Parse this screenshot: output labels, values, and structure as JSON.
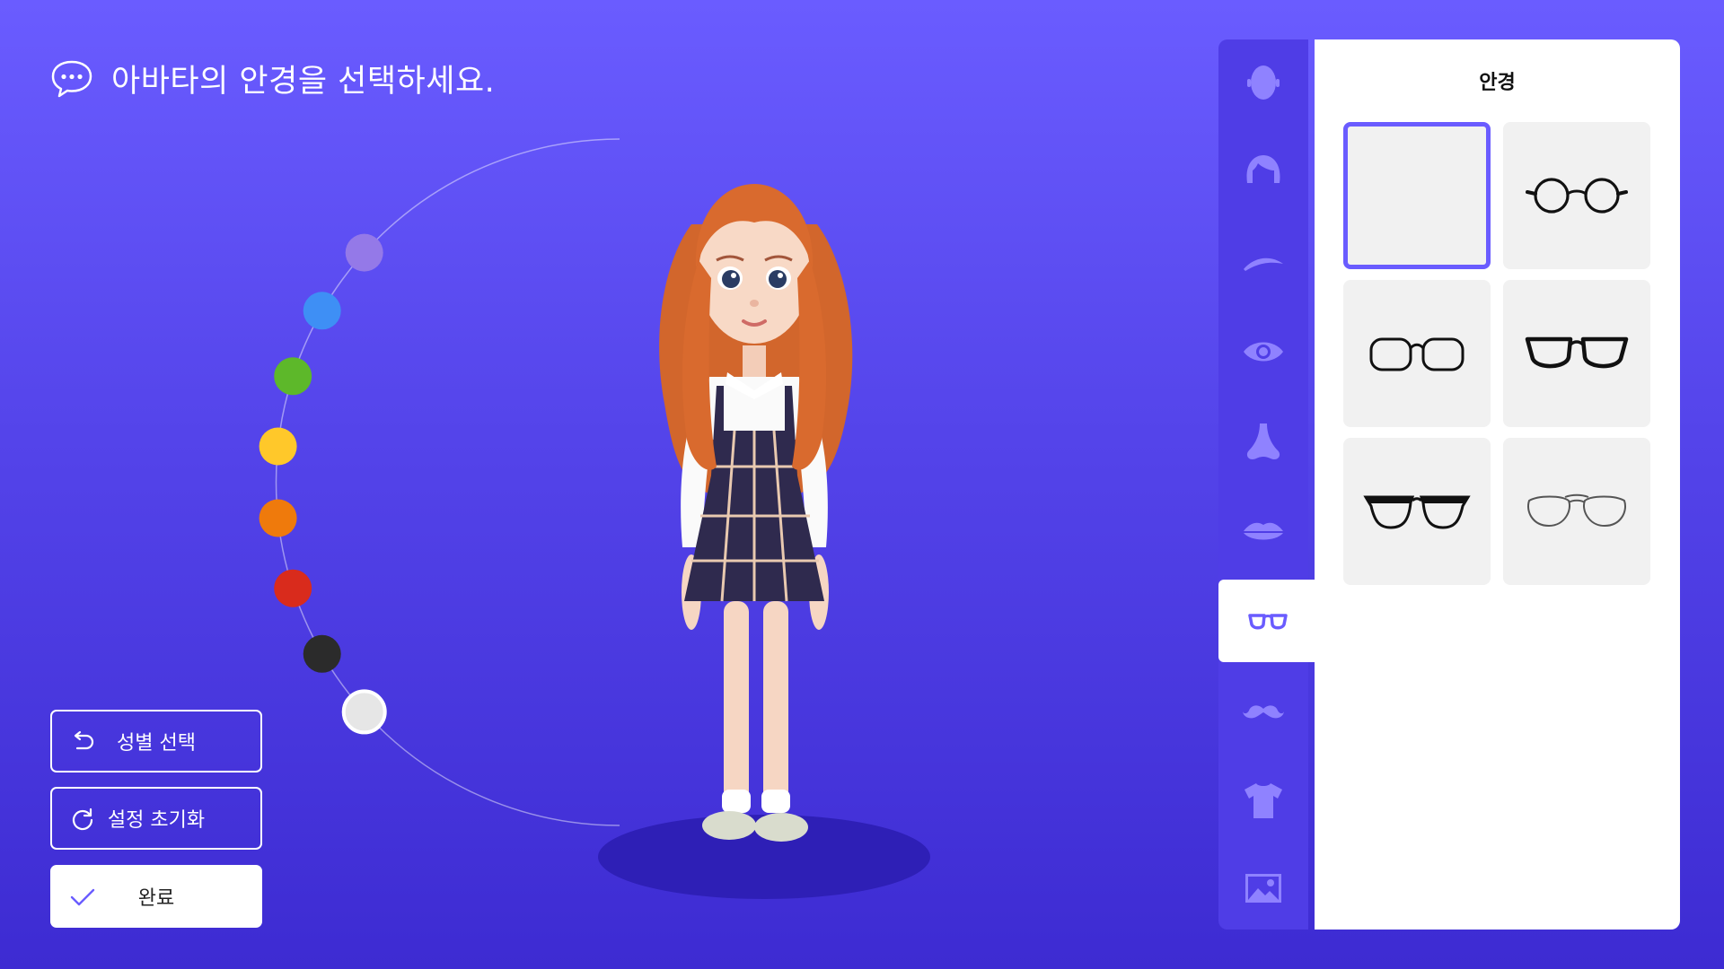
{
  "instruction": {
    "text": "아바타의 안경을 선택하세요.",
    "icon": "chat-bubble-icon"
  },
  "colors": {
    "swatches": [
      "#e6e6e6",
      "#2b2b2b",
      "#d92b1c",
      "#ef7a0c",
      "#ffc82a",
      "#5db82a",
      "#3e8ff5",
      "#9479e8"
    ],
    "selected_index": 0,
    "accent": "#6a5cff"
  },
  "left_buttons": {
    "gender": {
      "label": "성별 선택",
      "icon": "undo-icon"
    },
    "reset": {
      "label": "설정 초기화",
      "icon": "refresh-icon"
    },
    "done": {
      "label": "완료",
      "icon": "check-icon"
    }
  },
  "categories": [
    {
      "id": "face",
      "icon": "face-shape-icon"
    },
    {
      "id": "hair",
      "icon": "hair-icon"
    },
    {
      "id": "eyebrow",
      "icon": "eyebrow-icon"
    },
    {
      "id": "eye",
      "icon": "eye-icon"
    },
    {
      "id": "nose",
      "icon": "nose-icon"
    },
    {
      "id": "lips",
      "icon": "lips-icon"
    },
    {
      "id": "glasses",
      "icon": "glasses-icon",
      "active": true
    },
    {
      "id": "mustache",
      "icon": "mustache-icon"
    },
    {
      "id": "clothes",
      "icon": "shirt-icon"
    },
    {
      "id": "background",
      "icon": "image-icon"
    }
  ],
  "panel": {
    "title": "안경",
    "options": [
      {
        "id": "none",
        "selected": true
      },
      {
        "id": "round-thin"
      },
      {
        "id": "rectangle"
      },
      {
        "id": "wayfarer"
      },
      {
        "id": "browline"
      },
      {
        "id": "aviator"
      }
    ]
  }
}
